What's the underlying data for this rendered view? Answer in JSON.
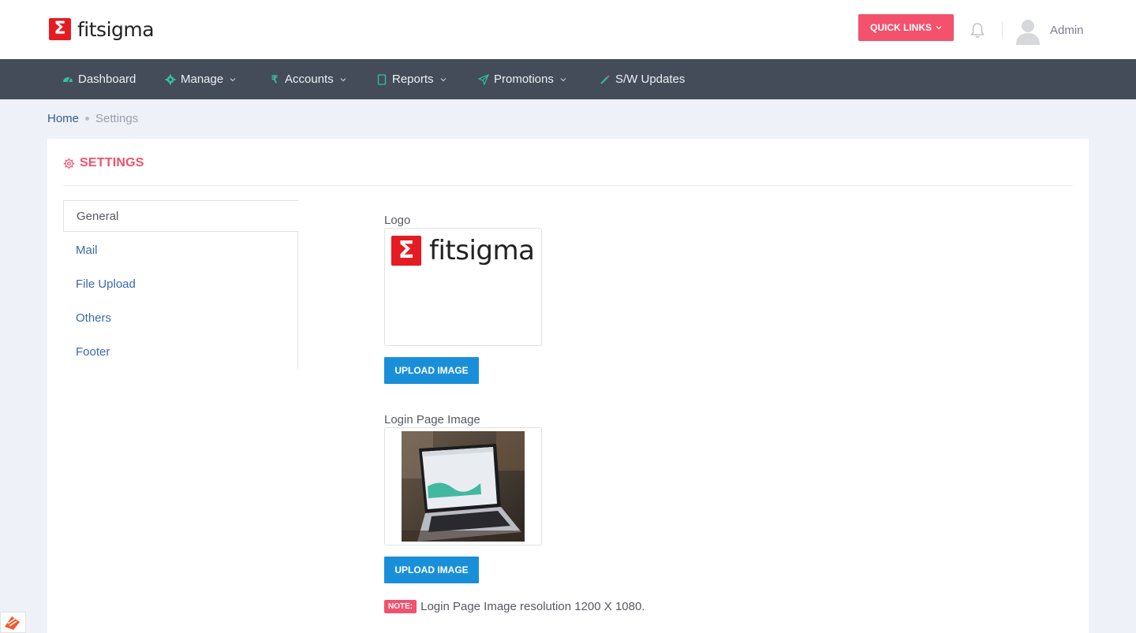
{
  "header": {
    "brand_mark": "Σ",
    "brand_name": "fitsigma",
    "quick_links_label": "QUICK LINKS",
    "user_name": "Admin"
  },
  "nav": {
    "items": [
      {
        "label": "Dashboard",
        "icon": "dashboard-icon"
      },
      {
        "label": "Manage",
        "icon": "gear-icon"
      },
      {
        "label": "Accounts",
        "icon": "rupee-icon"
      },
      {
        "label": "Reports",
        "icon": "document-icon"
      },
      {
        "label": "Promotions",
        "icon": "paper-plane-icon"
      },
      {
        "label": "S/W Updates",
        "icon": "magic-wand-icon"
      }
    ]
  },
  "breadcrumb": {
    "home": "Home",
    "current": "Settings"
  },
  "card": {
    "title": "SETTINGS"
  },
  "settings_tabs": [
    {
      "label": "General",
      "active": true
    },
    {
      "label": "Mail",
      "active": false
    },
    {
      "label": "File Upload",
      "active": false
    },
    {
      "label": "Others",
      "active": false
    },
    {
      "label": "Footer",
      "active": false
    }
  ],
  "form": {
    "logo_label": "Logo",
    "logo_preview": {
      "mark": "Σ",
      "name": "fitsigma"
    },
    "upload_button_label": "UPLOAD IMAGE",
    "login_image_label": "Login Page Image",
    "note_badge": "NOTE:",
    "note_text": "Login Page Image resolution 1200 X 1080."
  },
  "colors": {
    "accent": "#f4516c",
    "brand_red": "#e51b23",
    "nav_bg": "#434c58",
    "button_blue": "#1a8fd9",
    "link_blue": "#3a6aab"
  }
}
